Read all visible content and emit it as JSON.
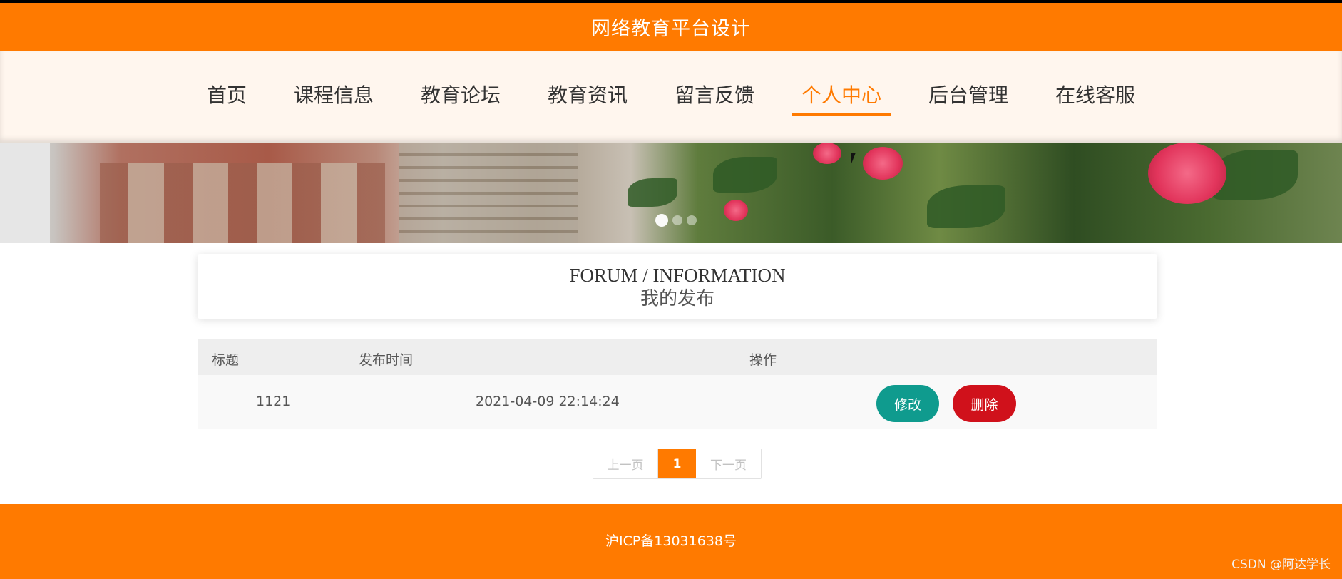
{
  "header": {
    "title": "网络教育平台设计"
  },
  "nav": {
    "items": [
      {
        "label": "首页",
        "active": false
      },
      {
        "label": "课程信息",
        "active": false
      },
      {
        "label": "教育论坛",
        "active": false
      },
      {
        "label": "教育资讯",
        "active": false
      },
      {
        "label": "留言反馈",
        "active": false
      },
      {
        "label": "个人中心",
        "active": true
      },
      {
        "label": "后台管理",
        "active": false
      },
      {
        "label": "在线客服",
        "active": false
      }
    ]
  },
  "banner": {
    "slide_count": 3,
    "active_slide": 1
  },
  "section": {
    "title_en": "FORUM / INFORMATION",
    "title_zh": "我的发布"
  },
  "table": {
    "columns": [
      "标题",
      "发布时间",
      "操作"
    ],
    "rows": [
      {
        "title": "1121",
        "time": "2021-04-09 22:14:24",
        "edit_label": "修改",
        "delete_label": "删除"
      }
    ]
  },
  "pagination": {
    "prev_label": "上一页",
    "current_page": "1",
    "next_label": "下一页"
  },
  "footer": {
    "icp": "沪ICP备13031638号"
  },
  "watermark": "CSDN @阿达学长",
  "colors": {
    "accent": "#ff7a00",
    "edit_button": "#0f9b8e",
    "delete_button": "#d0111b"
  }
}
